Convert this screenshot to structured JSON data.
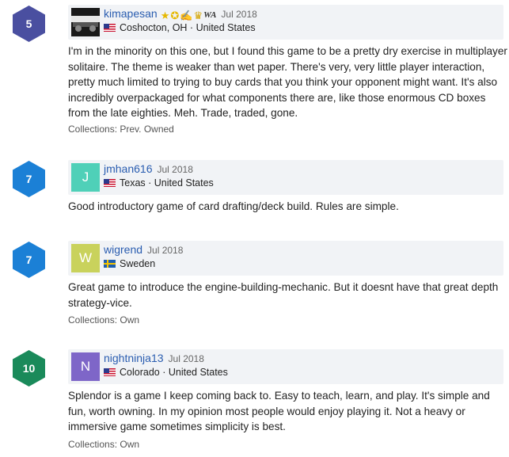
{
  "reviews": [
    {
      "rating": "5",
      "rating_color": "#4a4fa0",
      "username": "kimapesan",
      "date": "Jul 2018",
      "location": "Coshocton, OH · United States",
      "text": "I'm in the minority on this one, but I found this game to be a pretty dry exercise in multiplayer solitaire. The theme is weaker than wet paper. There's very, very little player interaction, pretty much limited to trying to buy cards that you think your opponent might want. It's also incredibly overpackaged for what components there are, like those enormous CD boxes from the late eighties. Meh. Trade, traded, gone.",
      "collections": "Collections: Prev. Owned",
      "badges": [
        "star-badge",
        "crown-star-badge",
        "thumb-badge",
        "trophy-badge",
        "wa-badge"
      ],
      "badge_wa_text": "WA"
    },
    {
      "rating": "7",
      "rating_color": "#1b80d6",
      "avatar_letter": "J",
      "avatar_color": "#4fd0b8",
      "username": "jmhan616",
      "date": "Jul 2018",
      "location": "Texas · United States",
      "text": "Good introductory game of card drafting/deck build. Rules are simple."
    },
    {
      "rating": "7",
      "rating_color": "#1b80d6",
      "avatar_letter": "W",
      "avatar_color": "#c9d25c",
      "username": "wigrend",
      "date": "Jul 2018",
      "location": "Sweden",
      "text": "Great game to introduce the engine-building-mechanic. But it doesnt have that great depth strategy-vice.",
      "collections": "Collections: Own"
    },
    {
      "rating": "10",
      "rating_color": "#1a8a5a",
      "avatar_letter": "N",
      "avatar_color": "#7e66c8",
      "username": "nightninja13",
      "date": "Jul 2018",
      "location": "Colorado · United States",
      "text": "Splendor is a game I keep coming back to. Easy to teach, learn, and play. It's simple and fun, worth owning. In my opinion most people would enjoy playing it. Not a heavy or immersive game sometimes simplicity is best.",
      "collections": "Collections: Own"
    }
  ]
}
